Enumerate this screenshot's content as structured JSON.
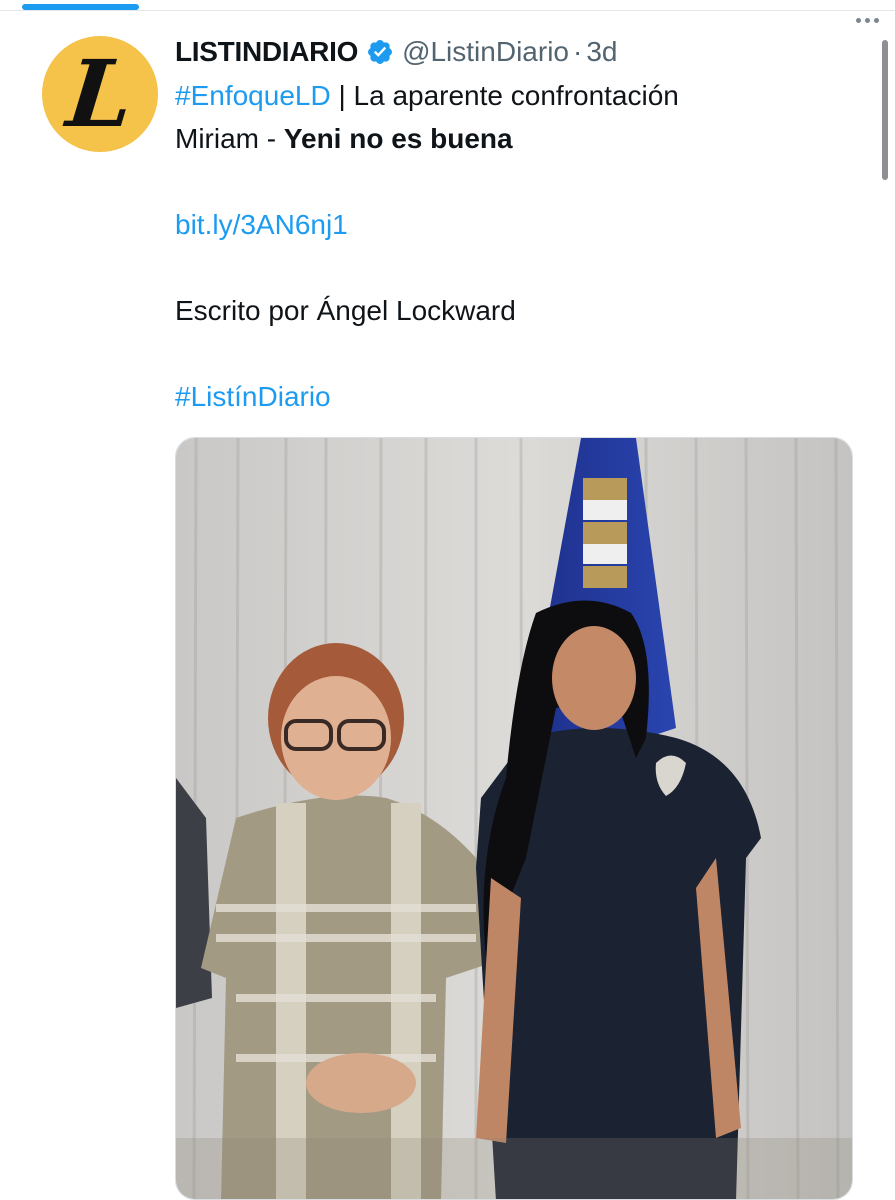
{
  "tweet": {
    "author": {
      "display_name": "LISTINDIARIO",
      "handle": "@ListinDiario",
      "separator": "·",
      "time": "3d",
      "avatar_letter": "L",
      "verified": true
    },
    "text": {
      "hashtag1": "#EnfoqueLD",
      "line1_rest": " | La aparente confrontación",
      "line2_prefix": "Miriam - ",
      "line2_bold": "Yeni no es buena",
      "link": "bit.ly/3AN6nj1",
      "author_line": "Escrito por Ángel Lockward",
      "hashtag2": "#ListínDiario"
    }
  },
  "icons": {
    "verified": "verified-badge-icon",
    "more": "more-options-icon"
  },
  "colors": {
    "accent": "#1d9bf0",
    "text": "#0f1419",
    "muted": "#536471",
    "avatar_bg": "#f5c24a"
  }
}
